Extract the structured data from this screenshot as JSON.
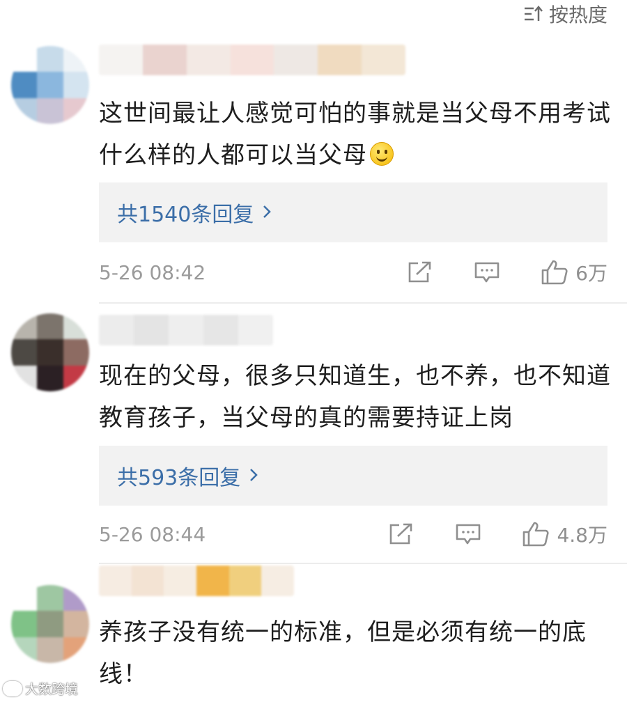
{
  "sort": {
    "label": "按热度",
    "icon": "sort-icon"
  },
  "comments": [
    {
      "avatar_colors": [
        "#ffffff",
        "#c7dbea",
        "#eef3f7",
        "#4f8cc2",
        "#8bb7de",
        "#d4e4f0",
        "#b6cde1",
        "#c9c3d6",
        "#e6c9cf"
      ],
      "username_colors": [
        "#f5f3f1",
        "#ead3cf",
        "#f3e9e4",
        "#f6e1dc",
        "#eee8e4",
        "#f0dbc0",
        "#f3e7d6"
      ],
      "text": "这世间最让人感觉可怕的事就是当父母不用考试 什么样的人都可以当父母",
      "has_emoji": true,
      "emoji_icon": "smile-emoji-icon",
      "replies_label": "共1540条回复",
      "time": "5-26 08:42",
      "likes": "6万"
    },
    {
      "avatar_colors": [
        "#b8b4ac",
        "#7c746c",
        "#d8dfd9",
        "#4d4944",
        "#3a2f2b",
        "#8d6b62",
        "#e2e2e2",
        "#2b2024",
        "#c33a45"
      ],
      "username_colors": [
        "#ececec",
        "#e4e4e4",
        "#eeeeee",
        "#e6e6e6",
        "#f0f0f0"
      ],
      "text": "现在的父母，很多只知道生，也不养，也不知道教育孩子，当父母的真的需要持证上岗",
      "has_emoji": false,
      "replies_label": "共593条回复",
      "time": "5-26 08:44",
      "likes": "4.8万"
    },
    {
      "avatar_colors": [
        "#ffffff",
        "#9ec7a2",
        "#b09bc9",
        "#7fc287",
        "#8f9b81",
        "#d3b59f",
        "#b5d6bc",
        "#c8b7a8",
        "#e3a27a"
      ],
      "username_colors": [
        "#f6ece2",
        "#f3e3d3",
        "#f6ede2",
        "#f1b54a",
        "#f0cf7e",
        "#f6ede3"
      ],
      "text": "养孩子没有统一的标准，但是必须有统一的底线！"
    }
  ],
  "actions": {
    "share_icon": "share-icon",
    "reply_icon": "comment-icon",
    "like_icon": "thumbs-up-icon"
  },
  "watermark": {
    "text": "大数跨境"
  },
  "colors": {
    "reply_link": "#3b6ea8",
    "meta_gray": "#9b9b9b",
    "reply_bg": "#f2f2f2"
  }
}
